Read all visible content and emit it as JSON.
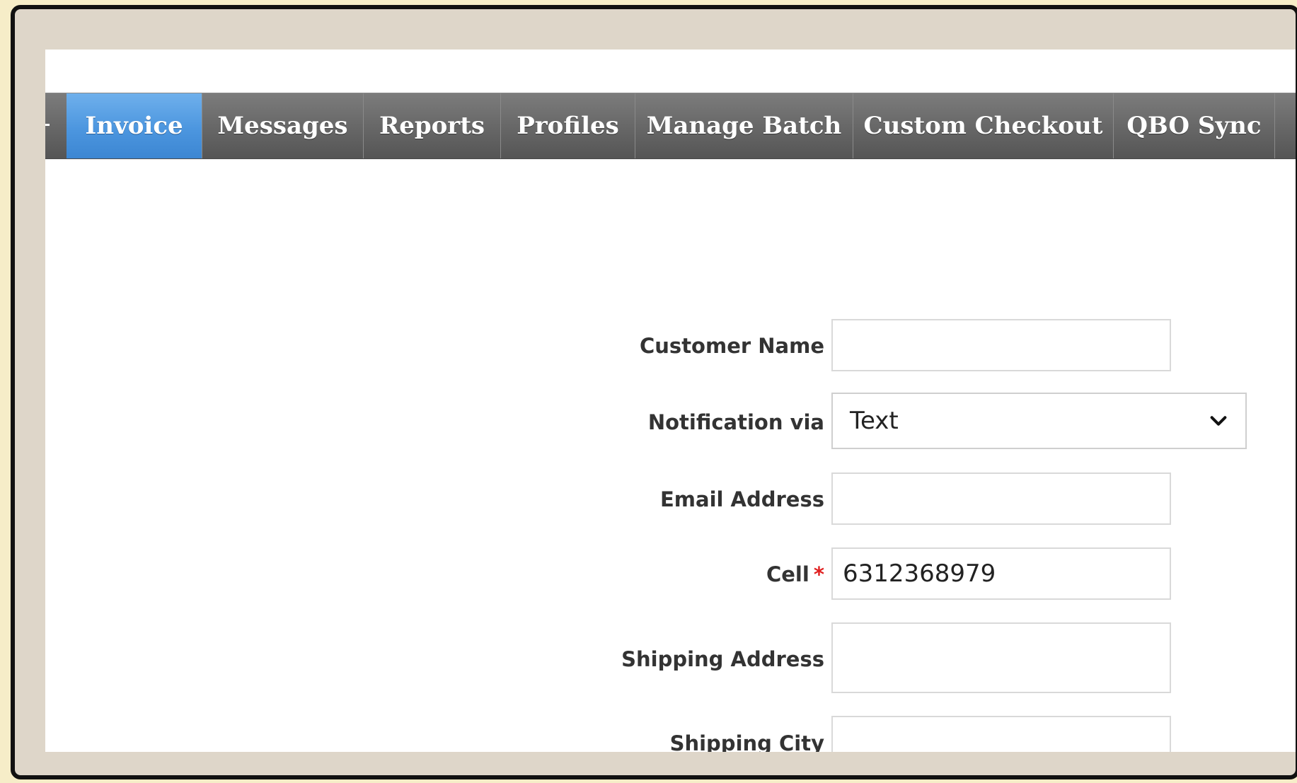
{
  "nav": {
    "tabs": [
      {
        "label": "Invoice",
        "active": true
      },
      {
        "label": "Messages",
        "active": false
      },
      {
        "label": "Reports",
        "active": false
      },
      {
        "label": "Profiles",
        "active": false
      },
      {
        "label": "Manage Batch",
        "active": false
      },
      {
        "label": "Custom Checkout",
        "active": false
      },
      {
        "label": "QBO Sync",
        "active": false
      }
    ]
  },
  "form": {
    "customer_name": {
      "label": "Customer Name",
      "value": ""
    },
    "notification": {
      "label": "Notification via",
      "selected": "Text"
    },
    "email": {
      "label": "Email Address",
      "value": ""
    },
    "cell": {
      "label": "Cell",
      "required_mark": "*",
      "value": "6312368979"
    },
    "shipping_address": {
      "label": "Shipping Address",
      "value": ""
    },
    "shipping_city": {
      "label": "Shipping City",
      "value": ""
    }
  },
  "colors": {
    "active_tab": "#4c96df",
    "navbar": "#666666",
    "required": "#e02020",
    "frame_bg": "#ded6c9"
  },
  "icons": {
    "select_arrow": "chevron-down-icon"
  }
}
